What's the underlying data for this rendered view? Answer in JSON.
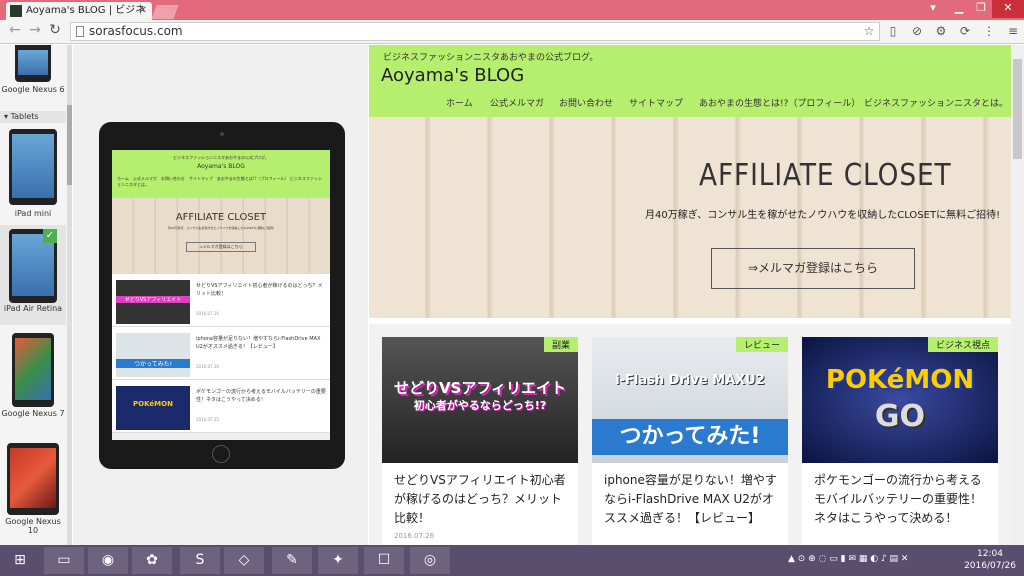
{
  "browser": {
    "tab_title": "Aoyama's BLOG | ビジネ",
    "url": "sorasfocus.com"
  },
  "devices": {
    "items": [
      {
        "label": "Google Nexus 6"
      },
      {
        "label": "iPad mini"
      },
      {
        "label": "iPad Air Retina",
        "selected": true
      },
      {
        "label": "Google Nexus 7"
      },
      {
        "label": "Google Nexus 10"
      }
    ],
    "section_tablets": "Tablets"
  },
  "site": {
    "tagline": "ビジネスファッションニスタあおやまの公式ブログ。",
    "title": "Aoyama's BLOG",
    "menu": [
      "ホーム",
      "公式メルマガ",
      "お問い合わせ",
      "サイトマップ",
      "あおやまの生態とは!?（プロフィール）",
      "ビジネスファッションニスタとは。"
    ],
    "hero_title": "AFFILIATE CLOSET",
    "hero_subtitle": "月40万稼ぎ、コンサル生を稼がせたノウハウを収納したCLOSETに無料ご招待!",
    "cta_label": "⇒メルマガ登録はこちら",
    "posts": [
      {
        "category": "副業",
        "image_text": "せどりVSアフィリエイト",
        "image_subtext": "初心者がやるならどっち!?",
        "title": "せどりVSアフィリエイト初心者が稼げるのはどっち？メリット比較！",
        "date": "2016.07.26"
      },
      {
        "category": "レビュー",
        "image_text": "i-Flash Drive MAXU2",
        "image_subtext": "つかってみた!",
        "title": "iphone容量が足りない！増やすならi-FlashDrive MAX U2がオススメ過ぎる！【レビュー】",
        "date": ""
      },
      {
        "category": "ビジネス視点",
        "image_text": "POKéMON",
        "image_subtext": "GO",
        "title": "ポケモンゴーの流行から考えるモバイルバッテリーの重要性！ネタはこうやって決める！",
        "date": ""
      }
    ],
    "mini_posts": [
      {
        "title": "せどりVSアフィリエイト初心者が稼げるのはどっち？メリット比較！",
        "date": "2016.07.26"
      },
      {
        "title": "iphone容量が足りない！増やすならi-FlashDrive MAX U2がオススメ過ぎる！【レビュー】",
        "date": "2016.07.26"
      },
      {
        "title": "ポケモンゴーの流行から考えるモバイルバッテリーの重要性！ネタはこうやって決める！",
        "date": "2016.07.25"
      }
    ]
  },
  "taskbar": {
    "time": "12:04",
    "date": "2016/07/26"
  }
}
